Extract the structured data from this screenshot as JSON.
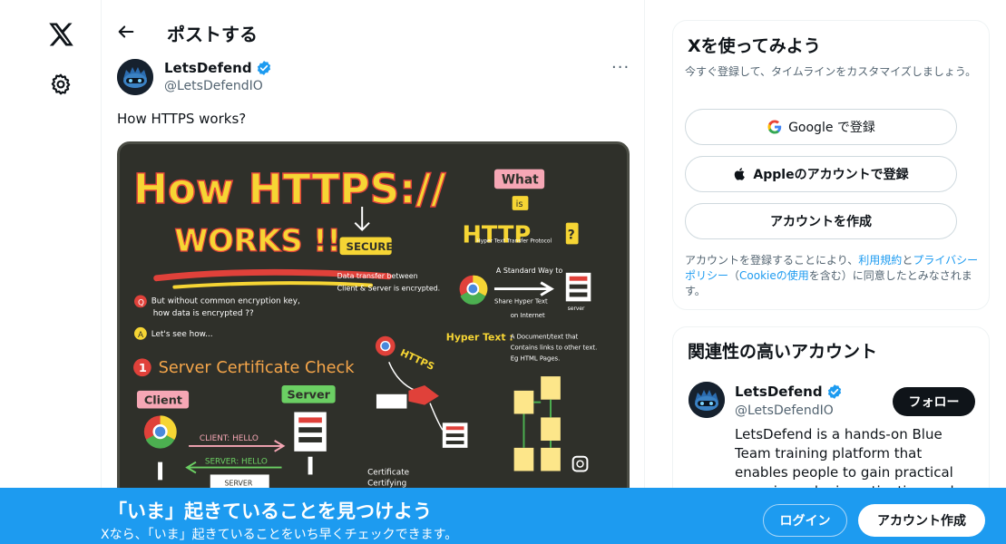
{
  "nav": {
    "logo": "x-logo-icon",
    "settings": "gear-icon"
  },
  "header": {
    "title": "ポストする",
    "back_icon": "arrow-left-icon"
  },
  "tweet": {
    "display_name": "LetsDefend",
    "handle": "@LetsDefendIO",
    "text": "How HTTPS works?",
    "more": "···",
    "image": {
      "title_line1": "How HTTPS://",
      "title_line2": "WORKS !!",
      "secure": "SECURE",
      "secure_note": "Data transfer between\nClient & Server is encrypted.",
      "what": "What",
      "is": "is",
      "http": "HTTP",
      "http_expansion": "Hyper Text Transfer Protocol",
      "std_way": "A Standard Way to\nShare Hyper Text on Internet",
      "server_small": "server",
      "q1": "But without common encryption key,\nhow data is encrypted ??",
      "q2": "Let's see how...",
      "hypertext_label": "Hyper Text :",
      "hypertext_def": "A Document/text that\nContains links to other text.\nEg HTML Pages.",
      "https": "HTTPS",
      "step1": "Server Certificate Check",
      "client": "Client",
      "server": "Server",
      "client_hello": "CLIENT: HELLO",
      "server_hello": "SERVER: HELLO",
      "server_box": "SERVER",
      "cert": "Certificate\nCertifying"
    }
  },
  "signup_card": {
    "title": "Xを使ってみよう",
    "subtitle": "今すぐ登録して、タイムラインをカスタマイズしましょう。",
    "google_label": "Google で登録",
    "apple_label": "Appleのアカウントで登録",
    "create_label": "アカウントを作成",
    "legal_pre": "アカウントを登録することにより、",
    "terms": "利用規約",
    "and": "と",
    "privacy": "プライバシーポリシー",
    "paren_open": "（",
    "cookie": "Cookieの使用",
    "legal_post": "を含む）に同意したとみなされます。"
  },
  "related_card": {
    "title": "関連性の高いアカウント",
    "name": "LetsDefend",
    "handle": "@LetsDefendIO",
    "follow_label": "フォロー",
    "bio": "LetsDefend is a hands-on Blue Team training platform that enables people to gain practical experience by investigating real cyber attacks inside"
  },
  "banner": {
    "title": "「いま」起きていることを見つけよう",
    "subtitle": "Xなら、「いま」起きていることをいち早くチェックできます。",
    "login_label": "ログイン",
    "signup_label": "アカウント作成"
  },
  "colors": {
    "accent": "#1d9bf0",
    "text": "#0f1419",
    "muted": "#536471"
  }
}
